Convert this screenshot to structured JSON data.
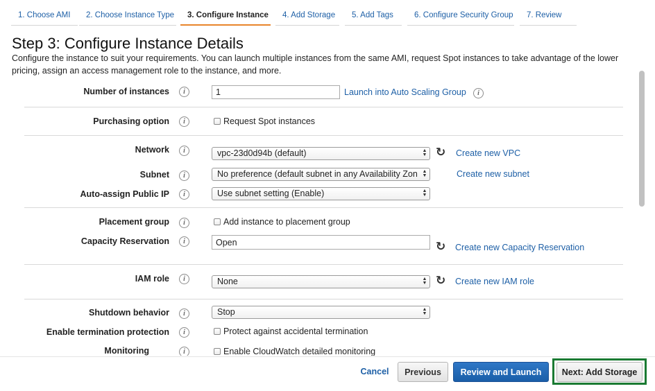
{
  "tabs": [
    {
      "label": "1. Choose AMI"
    },
    {
      "label": "2. Choose Instance Type"
    },
    {
      "label": "3. Configure Instance"
    },
    {
      "label": "4. Add Storage"
    },
    {
      "label": "5. Add Tags"
    },
    {
      "label": "6. Configure Security Group"
    },
    {
      "label": "7. Review"
    }
  ],
  "active_tab": "3. Configure Instance",
  "page": {
    "title": "Step 3: Configure Instance Details",
    "description": "Configure the instance to suit your requirements. You can launch multiple instances from the same AMI, request Spot instances to take advantage of the lower pricing, assign an access management role to the instance, and more."
  },
  "form": {
    "number_of_instances": {
      "label": "Number of instances",
      "value": "1",
      "link": "Launch into Auto Scaling Group"
    },
    "purchasing_option": {
      "label": "Purchasing option",
      "checkbox": "Request Spot instances"
    },
    "network": {
      "label": "Network",
      "value": "vpc-23d0d94b (default)",
      "link": "Create new VPC"
    },
    "subnet": {
      "label": "Subnet",
      "value": "No preference (default subnet in any Availability Zon",
      "link": "Create new subnet"
    },
    "auto_assign_ip": {
      "label": "Auto-assign Public IP",
      "value": "Use subnet setting (Enable)"
    },
    "placement_group": {
      "label": "Placement group",
      "checkbox": "Add instance to placement group"
    },
    "capacity_reservation": {
      "label": "Capacity Reservation",
      "value": "Open",
      "link": "Create new Capacity Reservation"
    },
    "iam_role": {
      "label": "IAM role",
      "value": "None",
      "link": "Create new IAM role"
    },
    "shutdown_behavior": {
      "label": "Shutdown behavior",
      "value": "Stop"
    },
    "termination_protection": {
      "label": "Enable termination protection",
      "checkbox": "Protect against accidental termination"
    },
    "monitoring": {
      "label": "Monitoring",
      "checkbox": "Enable CloudWatch detailed monitoring"
    }
  },
  "info_glyph": "i",
  "icons": {
    "info": "info-circle-icon",
    "refresh": "refresh-icon",
    "select_arrows": "select-arrows-icon"
  },
  "footer": {
    "cancel": "Cancel",
    "previous": "Previous",
    "review": "Review and Launch",
    "next": "Next: Add Storage"
  },
  "colors": {
    "link": "#1d5fa6",
    "primary_button": "#1a5ea8",
    "active_tab_underline": "#e8842a",
    "highlight_box": "#1a7a32"
  }
}
